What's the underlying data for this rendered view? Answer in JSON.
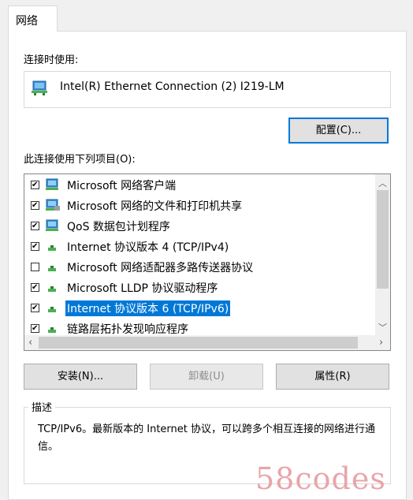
{
  "tabs": [
    {
      "label": "网络"
    }
  ],
  "connect_using": {
    "label": "连接时使用:",
    "adapter_name": "Intel(R) Ethernet Connection (2) I219-LM",
    "configure_button": "配置(C)..."
  },
  "items_section": {
    "label": "此连接使用下列项目(O):",
    "items": [
      {
        "label": "Microsoft 网络客户端",
        "checked": true,
        "icon": "network-client-icon",
        "selected": false
      },
      {
        "label": "Microsoft 网络的文件和打印机共享",
        "checked": true,
        "icon": "file-printer-sharing-icon",
        "selected": false
      },
      {
        "label": "QoS 数据包计划程序",
        "checked": true,
        "icon": "qos-scheduler-icon",
        "selected": false
      },
      {
        "label": "Internet 协议版本 4 (TCP/IPv4)",
        "checked": true,
        "icon": "protocol-icon",
        "selected": false
      },
      {
        "label": "Microsoft 网络适配器多路传送器协议",
        "checked": false,
        "icon": "protocol-icon",
        "selected": false
      },
      {
        "label": "Microsoft LLDP 协议驱动程序",
        "checked": true,
        "icon": "protocol-icon",
        "selected": false
      },
      {
        "label": "Internet 协议版本 6 (TCP/IPv6)",
        "checked": true,
        "icon": "protocol-icon",
        "selected": true
      },
      {
        "label": "链路层拓扑发现响应程序",
        "checked": true,
        "icon": "protocol-icon",
        "selected": false
      }
    ]
  },
  "buttons": {
    "install": "安装(N)...",
    "uninstall": "卸载(U)",
    "properties": "属性(R)"
  },
  "description": {
    "title": "描述",
    "text": "TCP/IPv6。最新版本的 Internet 协议，可以跨多个相互连接的网络进行通信。"
  },
  "watermark": "58codes",
  "colors": {
    "selection": "#0078d7",
    "primary_border": "#0078d7"
  }
}
